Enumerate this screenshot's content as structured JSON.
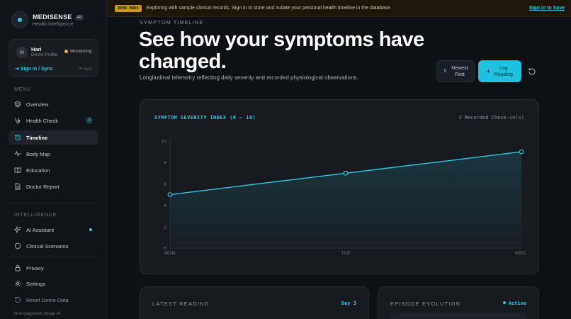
{
  "brand": {
    "name": "MEDISENSE",
    "ai_badge": "AI",
    "tagline": "Health Intelligence"
  },
  "profile": {
    "initial": "H",
    "name": "Hari",
    "role": "Demo Profile",
    "status": "Monitoring",
    "signin": "Sign In / Sync",
    "sync_note": "sym"
  },
  "menu": {
    "label": "MENU",
    "items": [
      {
        "label": "Overview",
        "icon": "layers-icon"
      },
      {
        "label": "Health Check",
        "icon": "stethoscope-icon",
        "badge": "3"
      },
      {
        "label": "Timeline",
        "icon": "history-icon",
        "active": true
      },
      {
        "label": "Body Map",
        "icon": "activity-icon"
      },
      {
        "label": "Education",
        "icon": "book-icon"
      },
      {
        "label": "Doctor Report",
        "icon": "report-icon"
      }
    ]
  },
  "intelligence": {
    "label": "INTELLIGENCE",
    "items": [
      {
        "label": "AI Assistant",
        "icon": "sparkle-icon"
      },
      {
        "label": "Clinical Scenarios",
        "icon": "shield-icon"
      }
    ]
  },
  "utility": {
    "items": [
      {
        "label": "Privacy",
        "icon": "lock-icon"
      },
      {
        "label": "Settings",
        "icon": "gear-icon"
      },
      {
        "label": "Reset Demo Data",
        "icon": "reset-icon"
      }
    ]
  },
  "footnote": "Non-diagnostic Image AI",
  "banner": {
    "tag": "DEMO MODE",
    "text": "Exploring with sample clinical records. Sign in to store and isolate your personal health timeline in the database.",
    "link": "Sign in to Save"
  },
  "header": {
    "eyebrow": "SYMPTOM TIMELINE",
    "title": "See how your symptoms have changed.",
    "subtitle": "Longitudinal telemetry reflecting daily severity and recorded physiological observations.",
    "sort_icon": "sort-icon",
    "sort_line1": "Newest",
    "sort_line2": "First",
    "log_icon": "plus-icon",
    "log_line1": "Log",
    "log_line2": "Reading",
    "refresh_icon": "refresh-icon"
  },
  "chart": {
    "title": "SYMPTOM SEVERITY INDEX (0 – 10)",
    "count_label": "3 Recorded Check-in(s)"
  },
  "chart_data": {
    "type": "area",
    "categories": [
      "MON",
      "TUE",
      "WED"
    ],
    "values": [
      5,
      7,
      9
    ],
    "ylim": [
      0,
      10
    ],
    "yticks": [
      0,
      2,
      4,
      6,
      8,
      10
    ],
    "title": "SYMPTOM SEVERITY INDEX (0 – 10)",
    "xlabel": "",
    "ylabel": "",
    "grid": false,
    "line_color": "#2ec7e0"
  },
  "latest": {
    "label": "LATEST READING",
    "day": "Day 3"
  },
  "episode": {
    "label": "EPISODE EVOLUTION",
    "status": "Active"
  },
  "colors": {
    "accent": "#2ec7e0",
    "warning": "#f2b630",
    "background": "#0d1014"
  }
}
